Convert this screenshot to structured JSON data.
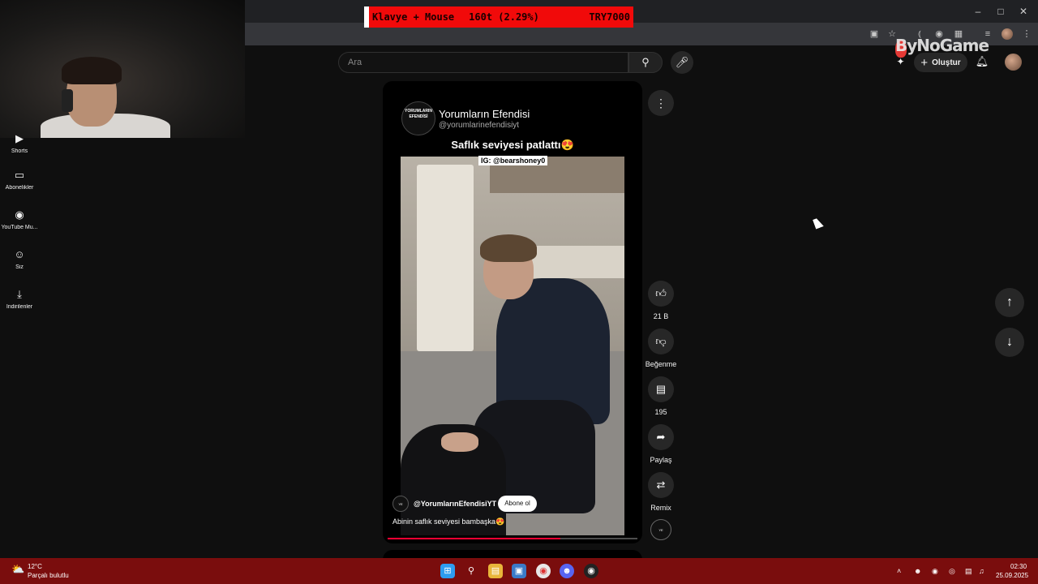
{
  "banner": {
    "item": "Klavye + Mouse",
    "amount": "160t (2.29%)",
    "goal": "TRY7000"
  },
  "watermark": {
    "brand": "ByNoGame"
  },
  "search": {
    "placeholder": "Ara"
  },
  "header": {
    "create_label": "Oluştur"
  },
  "guide": {
    "items": [
      {
        "label": "Shorts",
        "icon": "shorts-icon"
      },
      {
        "label": "Abonelikler",
        "icon": "subscriptions-icon"
      },
      {
        "label": "YouTube Mu...",
        "icon": "youtube-music-icon"
      },
      {
        "label": "Siz",
        "icon": "user-icon"
      },
      {
        "label": "İndirilenler",
        "icon": "download-icon"
      }
    ]
  },
  "short": {
    "channel_logo_text": "YORUMLARIN EFENDİSİ",
    "channel_name": "Yorumların Efendisi",
    "channel_handle": "@yorumlarinefendisiyt",
    "title": "Saflık seviyesi patlattı😍",
    "ig_tag": "IG: @bearshoney0",
    "overlay_channel": "@YorumlarınEfendisiYT",
    "subscribe_label": "Abone ol",
    "description": "Abinin saflık seviyesi bambaşka😍",
    "progress": 0.69
  },
  "actions": {
    "like_count": "21 B",
    "dislike_label": "Beğenme",
    "comment_count": "195",
    "share_label": "Paylaş",
    "remix_label": "Remix"
  },
  "taskbar": {
    "weather_temp": "12°C",
    "weather_desc": "Parçalı bulutlu",
    "time": "02:30",
    "date": "25.09.2025",
    "apps": [
      "windows-start-icon",
      "search-icon",
      "file-explorer-icon",
      "task-view-icon",
      "chrome-icon",
      "discord-icon",
      "obs-icon"
    ]
  },
  "colors": {
    "accent_red": "#ff0033",
    "banner_red": "#f10a0a",
    "taskbar": "#7a0d0d"
  }
}
